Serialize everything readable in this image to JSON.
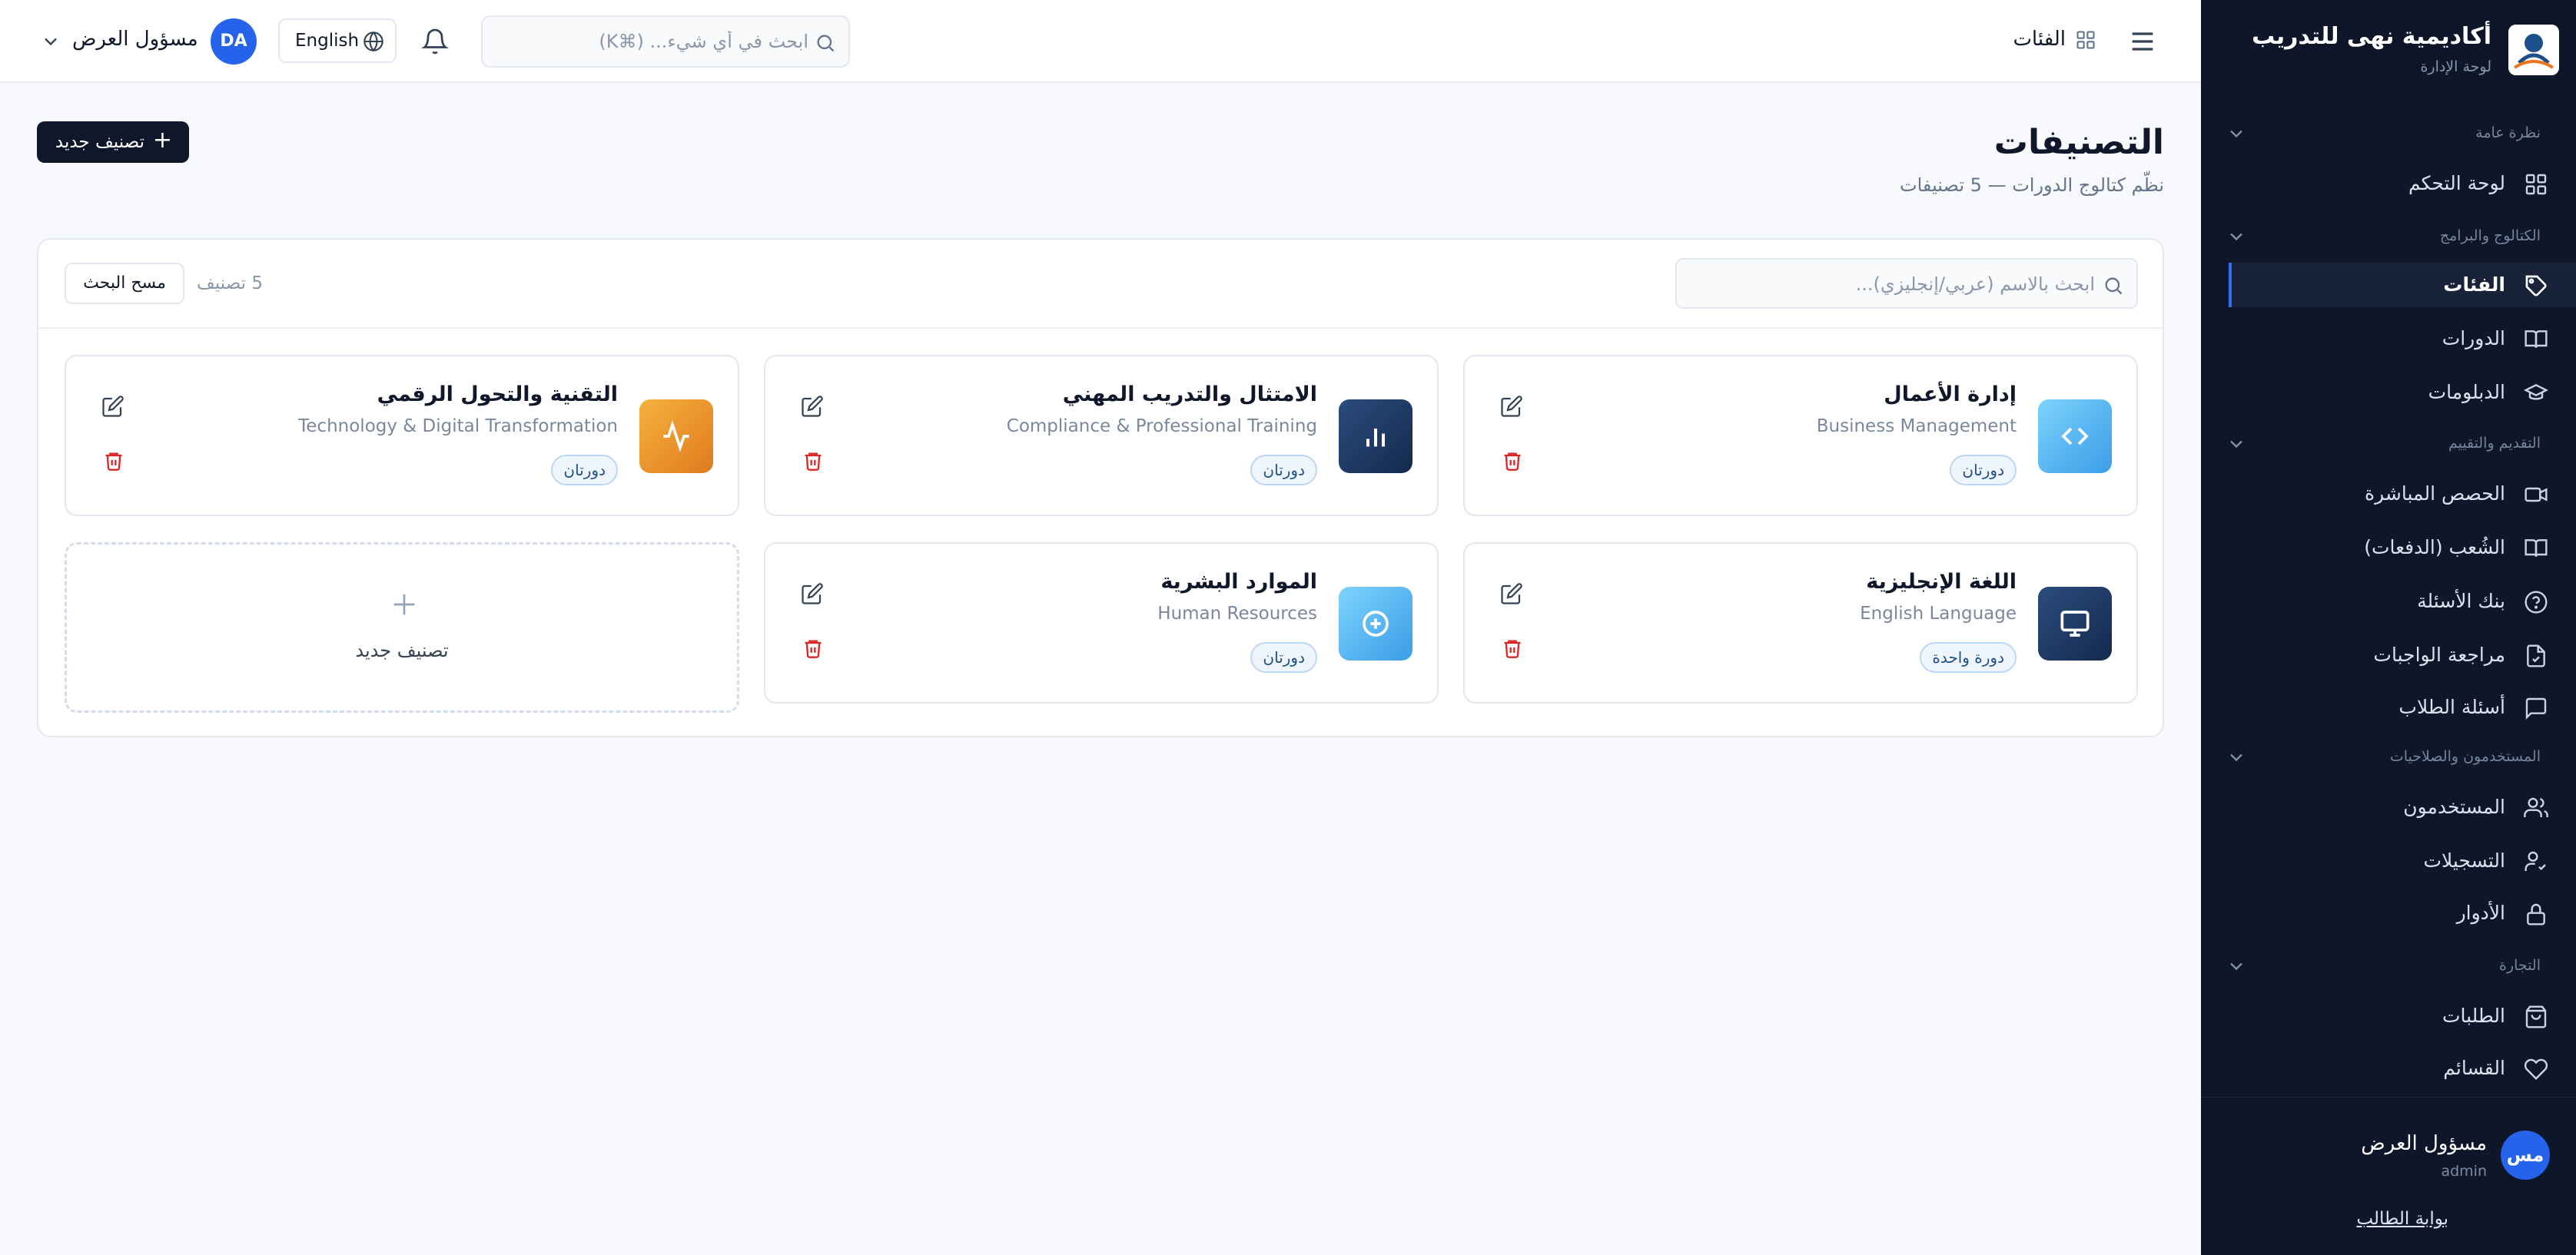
{
  "app": {
    "name": "أكاديمية نهى للتدريب",
    "subtitle": "لوحة الإدارة"
  },
  "sidebar": {
    "sections": [
      {
        "label": "نظرة عامة",
        "items": [
          {
            "label": "لوحة التحكم",
            "icon": "dashboard-grid-icon"
          }
        ]
      },
      {
        "label": "الكتالوج والبرامج",
        "items": [
          {
            "label": "الفئات",
            "icon": "tag-icon",
            "active": true
          },
          {
            "label": "الدورات",
            "icon": "book-open-icon"
          },
          {
            "label": "الدبلومات",
            "icon": "graduation-cap-icon"
          }
        ]
      },
      {
        "label": "التقديم والتقييم",
        "items": [
          {
            "label": "الحصص المباشرة",
            "icon": "video-icon"
          },
          {
            "label": "الشُعب (الدفعات)",
            "icon": "book-icon"
          },
          {
            "label": "بنك الأسئلة",
            "icon": "help-circle-icon"
          },
          {
            "label": "مراجعة الواجبات",
            "icon": "file-check-icon"
          },
          {
            "label": "أسئلة الطلاب",
            "icon": "message-square-icon"
          }
        ]
      },
      {
        "label": "المستخدمون والصلاحيات",
        "items": [
          {
            "label": "المستخدمون",
            "icon": "users-icon"
          },
          {
            "label": "التسجيلات",
            "icon": "user-check-icon"
          },
          {
            "label": "الأدوار",
            "icon": "lock-icon"
          }
        ]
      },
      {
        "label": "التجارة",
        "items": [
          {
            "label": "الطلبات",
            "icon": "shopping-bag-icon"
          },
          {
            "label": "القسائم",
            "icon": "heart-icon"
          }
        ]
      }
    ],
    "user": {
      "initials": "مس",
      "name": "مسؤول العرض",
      "role": "admin"
    },
    "portal_link": "بوابة الطالب"
  },
  "topbar": {
    "breadcrumb": "الفئات",
    "search_placeholder": "ابحث في أي شيء... (⌘K)",
    "language": "English",
    "user_initials": "DA",
    "user_name": "مسؤول العرض"
  },
  "page": {
    "title": "التصنيفات",
    "subtitle": "نظّم كتالوج الدورات — 5 تصنيفات",
    "new_button": "تصنيف جديد",
    "filter_placeholder": "ابحث بالاسم (عربي/إنجليزي)...",
    "count": "5 تصنيف",
    "clear_button": "مسح البحث"
  },
  "categories": [
    {
      "title_ar": "إدارة الأعمال",
      "title_en": "Business Management",
      "badge": "دورتان",
      "icon": "code-icon",
      "color": "#5ab8f5"
    },
    {
      "title_ar": "الامتثال والتدريب المهني",
      "title_en": "Compliance & Professional Training",
      "badge": "دورتان",
      "icon": "bar-chart-icon",
      "color": "#1e3a66"
    },
    {
      "title_ar": "التقنية والتحول الرقمي",
      "title_en": "Technology & Digital Transformation",
      "badge": "دورتان",
      "icon": "activity-icon",
      "color": "#ea9b2c"
    },
    {
      "title_ar": "اللغة الإنجليزية",
      "title_en": "English Language",
      "badge": "دورة واحدة",
      "icon": "monitor-icon",
      "color": "#1e3a66"
    },
    {
      "title_ar": "الموارد البشرية",
      "title_en": "Human Resources",
      "badge": "دورتان",
      "icon": "plus-circle-icon",
      "color": "#5ab8f5"
    }
  ],
  "add_card": {
    "label": "تصنيف جديد"
  },
  "colors": {
    "sidebar_bg": "#0d1729",
    "accent": "#2563eb",
    "primary_button": "#0f172a",
    "delete": "#dc2626"
  }
}
